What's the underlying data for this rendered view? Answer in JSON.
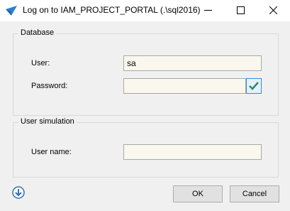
{
  "window": {
    "title": "Log on to IAM_PROJECT_PORTAL (.\\sql2016)",
    "controls": [
      "minimize-icon",
      "maximize-icon",
      "close-icon"
    ]
  },
  "database": {
    "legend": "Database",
    "user_label": "User:",
    "user_value": "sa",
    "password_label": "Password:",
    "password_value": "",
    "check_icon": "checkmark-icon",
    "check_color": "#2e8b57"
  },
  "user_simulation": {
    "legend": "User simulation",
    "username_label": "User name:",
    "username_value": ""
  },
  "footer": {
    "info_icon": "download-circle-icon",
    "ok_label": "OK",
    "cancel_label": "Cancel"
  },
  "colors": {
    "input_background": "#faf8ee",
    "accent_blue": "#2f6fb6"
  }
}
